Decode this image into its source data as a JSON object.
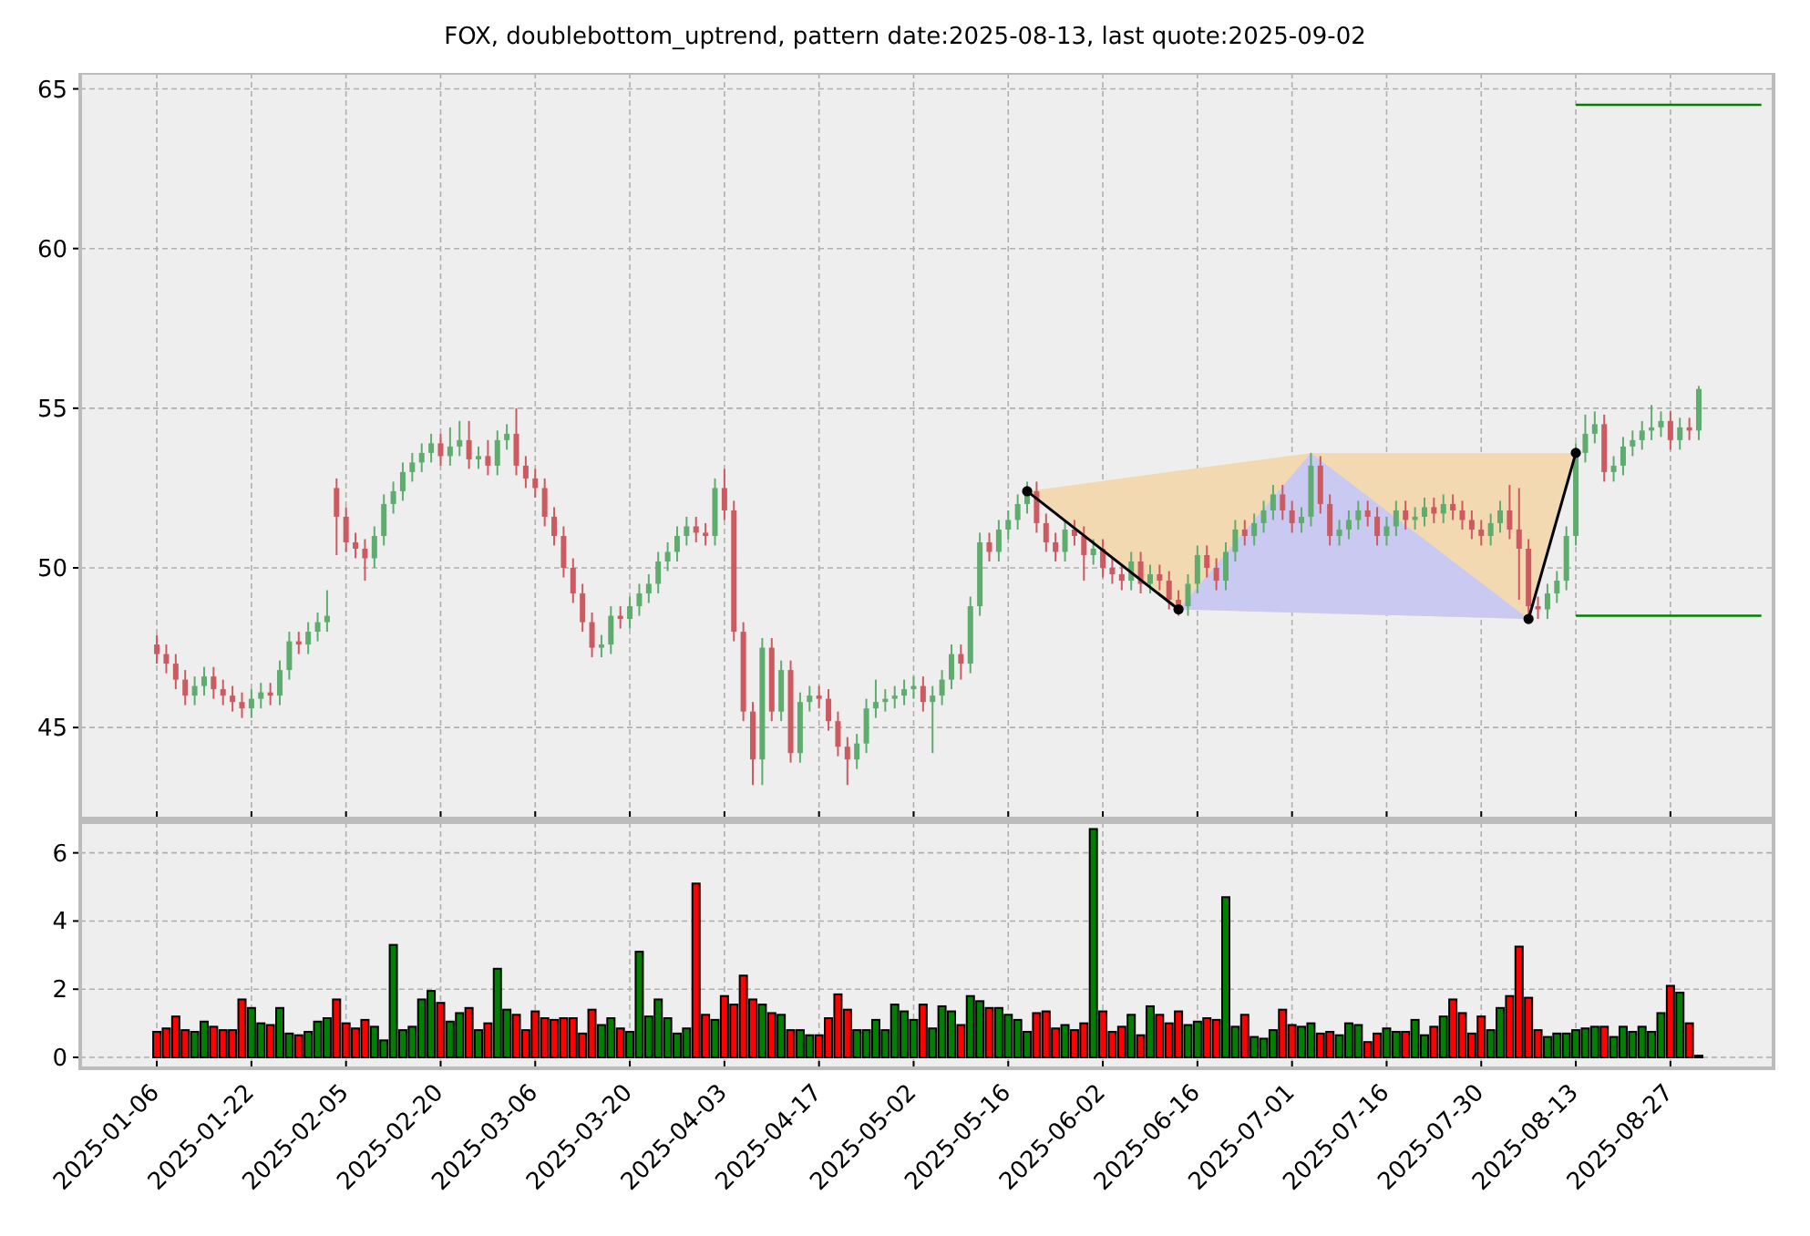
{
  "title": "FOX, doublebottom_uptrend, pattern date:2025-08-13, last quote:2025-09-02",
  "price_chart": {
    "chart_data": {
      "type": "candlestick",
      "grid": true,
      "ylim": [
        42.15,
        65.5
      ],
      "yticks": [
        45,
        50,
        55,
        60,
        65
      ],
      "ohlc": [
        [
          47.6,
          47.9,
          47.0,
          47.3
        ],
        [
          47.3,
          47.6,
          46.7,
          47.0
        ],
        [
          47.0,
          47.3,
          46.2,
          46.5
        ],
        [
          46.5,
          46.8,
          45.7,
          46.0
        ],
        [
          46.0,
          46.6,
          45.7,
          46.3
        ],
        [
          46.3,
          46.9,
          46.0,
          46.6
        ],
        [
          46.6,
          46.9,
          45.9,
          46.2
        ],
        [
          46.2,
          46.5,
          45.7,
          46.0
        ],
        [
          46.0,
          46.3,
          45.5,
          45.8
        ],
        [
          45.8,
          46.1,
          45.3,
          45.6
        ],
        [
          45.6,
          46.2,
          45.3,
          45.9
        ],
        [
          45.9,
          46.4,
          45.6,
          46.1
        ],
        [
          46.1,
          46.4,
          45.7,
          46.0
        ],
        [
          46.0,
          47.1,
          45.7,
          46.8
        ],
        [
          46.8,
          48.0,
          46.5,
          47.7
        ],
        [
          47.7,
          48.0,
          47.3,
          47.6
        ],
        [
          47.6,
          48.3,
          47.3,
          48.0
        ],
        [
          48.0,
          48.6,
          47.7,
          48.3
        ],
        [
          48.3,
          49.3,
          48.0,
          48.5
        ],
        [
          52.5,
          52.8,
          50.4,
          51.6
        ],
        [
          51.6,
          51.9,
          50.5,
          50.8
        ],
        [
          50.8,
          51.1,
          50.3,
          50.6
        ],
        [
          50.6,
          50.9,
          49.6,
          50.3
        ],
        [
          50.3,
          51.3,
          50.0,
          51.0
        ],
        [
          51.0,
          52.3,
          50.7,
          52.0
        ],
        [
          52.0,
          52.7,
          51.7,
          52.4
        ],
        [
          52.4,
          53.3,
          52.1,
          53.0
        ],
        [
          53.0,
          53.6,
          52.7,
          53.3
        ],
        [
          53.3,
          53.9,
          53.0,
          53.6
        ],
        [
          53.6,
          54.2,
          53.3,
          53.9
        ],
        [
          53.9,
          54.2,
          53.2,
          53.5
        ],
        [
          53.5,
          54.4,
          53.2,
          53.8
        ],
        [
          53.8,
          54.6,
          53.5,
          54.0
        ],
        [
          54.0,
          54.6,
          53.1,
          53.4
        ],
        [
          53.4,
          53.8,
          53.1,
          53.5
        ],
        [
          53.5,
          54.0,
          52.9,
          53.2
        ],
        [
          53.2,
          54.3,
          52.9,
          54.0
        ],
        [
          54.0,
          54.5,
          53.7,
          54.2
        ],
        [
          54.2,
          55.0,
          52.9,
          53.2
        ],
        [
          53.2,
          53.5,
          52.5,
          52.8
        ],
        [
          52.8,
          53.1,
          52.2,
          52.5
        ],
        [
          52.5,
          52.8,
          51.3,
          51.6
        ],
        [
          51.6,
          51.9,
          50.7,
          51.0
        ],
        [
          51.0,
          51.3,
          49.7,
          50.0
        ],
        [
          50.0,
          50.3,
          48.9,
          49.2
        ],
        [
          49.2,
          49.5,
          48.0,
          48.3
        ],
        [
          48.3,
          48.6,
          47.2,
          47.5
        ],
        [
          47.5,
          47.9,
          47.2,
          47.6
        ],
        [
          47.6,
          48.8,
          47.3,
          48.5
        ],
        [
          48.5,
          48.8,
          48.1,
          48.4
        ],
        [
          48.4,
          49.1,
          48.1,
          48.8
        ],
        [
          48.8,
          49.5,
          48.5,
          49.2
        ],
        [
          49.2,
          49.8,
          48.9,
          49.5
        ],
        [
          49.5,
          50.5,
          49.2,
          50.2
        ],
        [
          50.2,
          50.8,
          49.9,
          50.5
        ],
        [
          50.5,
          51.3,
          50.2,
          51.0
        ],
        [
          51.0,
          51.6,
          50.7,
          51.3
        ],
        [
          51.3,
          51.6,
          50.8,
          51.1
        ],
        [
          51.1,
          51.4,
          50.7,
          51.0
        ],
        [
          51.0,
          52.8,
          50.7,
          52.5
        ],
        [
          52.5,
          53.1,
          51.5,
          51.8
        ],
        [
          51.8,
          52.1,
          47.7,
          48.0
        ],
        [
          48.0,
          48.3,
          45.2,
          45.5
        ],
        [
          45.5,
          45.8,
          43.2,
          44.0
        ],
        [
          44.0,
          47.8,
          43.2,
          47.5
        ],
        [
          47.5,
          47.8,
          45.2,
          45.5
        ],
        [
          45.5,
          47.1,
          45.2,
          46.8
        ],
        [
          46.8,
          47.1,
          43.9,
          44.2
        ],
        [
          44.2,
          46.1,
          43.9,
          45.8
        ],
        [
          45.8,
          46.3,
          45.5,
          46.0
        ],
        [
          46.0,
          46.3,
          45.6,
          45.9
        ],
        [
          45.9,
          46.2,
          44.9,
          45.2
        ],
        [
          45.2,
          45.5,
          44.1,
          44.4
        ],
        [
          44.4,
          44.7,
          43.2,
          44.0
        ],
        [
          44.0,
          44.8,
          43.7,
          44.5
        ],
        [
          44.5,
          45.9,
          44.2,
          45.6
        ],
        [
          45.6,
          46.5,
          45.3,
          45.8
        ],
        [
          45.8,
          46.2,
          45.5,
          45.9
        ],
        [
          45.9,
          46.3,
          45.6,
          46.0
        ],
        [
          46.0,
          46.5,
          45.7,
          46.2
        ],
        [
          46.2,
          46.6,
          45.9,
          46.3
        ],
        [
          46.3,
          46.6,
          45.5,
          45.8
        ],
        [
          45.8,
          46.3,
          44.2,
          46.0
        ],
        [
          46.0,
          46.8,
          45.7,
          46.5
        ],
        [
          46.5,
          47.6,
          46.2,
          47.3
        ],
        [
          47.3,
          47.6,
          46.5,
          47.0
        ],
        [
          47.0,
          49.1,
          46.7,
          48.8
        ],
        [
          48.8,
          51.1,
          48.5,
          50.8
        ],
        [
          50.8,
          51.1,
          50.2,
          50.5
        ],
        [
          50.5,
          51.5,
          50.2,
          51.2
        ],
        [
          51.2,
          51.8,
          50.9,
          51.5
        ],
        [
          51.5,
          52.3,
          51.2,
          52.0
        ],
        [
          52.0,
          52.7,
          51.7,
          52.4
        ],
        [
          52.4,
          52.7,
          51.1,
          51.4
        ],
        [
          51.4,
          51.7,
          50.5,
          50.8
        ],
        [
          50.8,
          51.1,
          50.2,
          50.5
        ],
        [
          50.5,
          51.5,
          50.2,
          51.2
        ],
        [
          51.2,
          51.5,
          50.7,
          51.0
        ],
        [
          51.0,
          51.3,
          49.6,
          50.4
        ],
        [
          50.4,
          50.9,
          50.1,
          50.6
        ],
        [
          50.6,
          50.9,
          49.7,
          50.0
        ],
        [
          50.0,
          50.3,
          49.5,
          49.8
        ],
        [
          49.8,
          50.1,
          49.3,
          49.6
        ],
        [
          49.6,
          50.5,
          49.3,
          50.2
        ],
        [
          50.2,
          50.5,
          49.2,
          49.5
        ],
        [
          49.5,
          50.1,
          49.2,
          49.8
        ],
        [
          49.8,
          50.1,
          49.3,
          49.6
        ],
        [
          49.6,
          49.9,
          48.7,
          49.0
        ],
        [
          49.0,
          49.3,
          48.5,
          48.8
        ],
        [
          48.8,
          49.8,
          48.5,
          49.5
        ],
        [
          49.5,
          50.7,
          49.2,
          50.4
        ],
        [
          50.4,
          50.7,
          49.7,
          50.0
        ],
        [
          50.0,
          50.3,
          49.3,
          49.6
        ],
        [
          49.6,
          50.8,
          49.3,
          50.5
        ],
        [
          50.5,
          51.5,
          50.2,
          51.2
        ],
        [
          51.2,
          51.5,
          50.7,
          51.0
        ],
        [
          51.0,
          51.7,
          50.7,
          51.4
        ],
        [
          51.4,
          52.1,
          51.1,
          51.8
        ],
        [
          51.8,
          52.6,
          51.5,
          52.3
        ],
        [
          52.3,
          52.6,
          51.5,
          51.8
        ],
        [
          51.8,
          52.1,
          51.1,
          51.4
        ],
        [
          51.4,
          51.9,
          51.1,
          51.6
        ],
        [
          51.6,
          53.6,
          51.3,
          53.2
        ],
        [
          53.2,
          53.5,
          51.7,
          52.0
        ],
        [
          52.0,
          52.3,
          50.7,
          51.0
        ],
        [
          51.0,
          51.5,
          50.7,
          51.2
        ],
        [
          51.2,
          51.8,
          50.9,
          51.5
        ],
        [
          51.5,
          52.1,
          51.2,
          51.8
        ],
        [
          51.8,
          52.1,
          51.3,
          51.6
        ],
        [
          51.6,
          51.9,
          50.7,
          51.0
        ],
        [
          51.0,
          51.6,
          50.7,
          51.3
        ],
        [
          51.3,
          52.1,
          51.0,
          51.8
        ],
        [
          51.8,
          52.1,
          51.2,
          51.5
        ],
        [
          51.5,
          51.9,
          51.2,
          51.6
        ],
        [
          51.6,
          52.2,
          51.3,
          51.9
        ],
        [
          51.9,
          52.2,
          51.4,
          51.7
        ],
        [
          51.7,
          52.3,
          51.4,
          52.0
        ],
        [
          52.0,
          52.3,
          51.5,
          51.8
        ],
        [
          51.8,
          52.1,
          51.2,
          51.5
        ],
        [
          51.5,
          51.8,
          50.9,
          51.2
        ],
        [
          51.2,
          51.5,
          50.7,
          51.0
        ],
        [
          51.0,
          51.7,
          50.7,
          51.4
        ],
        [
          51.4,
          52.1,
          51.1,
          51.8
        ],
        [
          51.8,
          52.6,
          50.9,
          51.2
        ],
        [
          51.2,
          52.5,
          49.0,
          50.6
        ],
        [
          50.6,
          50.9,
          48.4,
          48.8
        ],
        [
          48.8,
          49.1,
          48.4,
          48.7
        ],
        [
          48.7,
          49.5,
          48.4,
          49.2
        ],
        [
          49.2,
          49.9,
          48.9,
          49.6
        ],
        [
          49.6,
          51.3,
          49.3,
          51.0
        ],
        [
          51.0,
          53.9,
          50.7,
          53.6
        ],
        [
          53.6,
          54.8,
          53.3,
          54.2
        ],
        [
          54.2,
          54.9,
          53.9,
          54.5
        ],
        [
          54.5,
          54.8,
          52.7,
          53.0
        ],
        [
          53.0,
          53.5,
          52.7,
          53.2
        ],
        [
          53.2,
          54.1,
          52.9,
          53.8
        ],
        [
          53.8,
          54.3,
          53.5,
          54.0
        ],
        [
          54.0,
          54.6,
          53.7,
          54.3
        ],
        [
          54.3,
          55.1,
          54.0,
          54.4
        ],
        [
          54.4,
          54.9,
          54.1,
          54.6
        ],
        [
          54.6,
          54.9,
          53.7,
          54.0
        ],
        [
          54.0,
          54.7,
          53.7,
          54.4
        ],
        [
          54.4,
          54.7,
          54.0,
          54.3
        ],
        [
          54.3,
          55.7,
          54.0,
          55.6
        ]
      ],
      "ref_lines": [
        {
          "axis": "y",
          "value": 64.5,
          "color": "#008000"
        },
        {
          "axis": "y",
          "value": 48.5,
          "color": "#008000"
        }
      ]
    }
  },
  "volume_chart": {
    "chart_data": {
      "type": "bar",
      "grid": true,
      "ylim": [
        -0.32,
        6.9
      ],
      "yticks": [
        0,
        2,
        4,
        6
      ],
      "categories": [
        "2025-01-06",
        null,
        null,
        null,
        null,
        null,
        null,
        null,
        null,
        null,
        "2025-01-22",
        null,
        null,
        null,
        null,
        null,
        null,
        null,
        null,
        null,
        "2025-02-05",
        null,
        null,
        null,
        null,
        null,
        null,
        null,
        null,
        null,
        "2025-02-20",
        null,
        null,
        null,
        null,
        null,
        null,
        null,
        null,
        null,
        "2025-03-06",
        null,
        null,
        null,
        null,
        null,
        null,
        null,
        null,
        null,
        "2025-03-20",
        null,
        null,
        null,
        null,
        null,
        null,
        null,
        null,
        null,
        "2025-04-03",
        null,
        null,
        null,
        null,
        null,
        null,
        null,
        null,
        null,
        "2025-04-17",
        null,
        null,
        null,
        null,
        null,
        null,
        null,
        null,
        null,
        "2025-05-02",
        null,
        null,
        null,
        null,
        null,
        null,
        null,
        null,
        null,
        "2025-05-16",
        null,
        null,
        null,
        null,
        null,
        null,
        null,
        null,
        null,
        "2025-06-02",
        null,
        null,
        null,
        null,
        null,
        null,
        null,
        null,
        null,
        "2025-06-16",
        null,
        null,
        null,
        null,
        null,
        null,
        null,
        null,
        null,
        "2025-07-01",
        null,
        null,
        null,
        null,
        null,
        null,
        null,
        null,
        null,
        "2025-07-16",
        null,
        null,
        null,
        null,
        null,
        null,
        null,
        null,
        null,
        "2025-07-30",
        null,
        null,
        null,
        null,
        null,
        null,
        null,
        null,
        null,
        "2025-08-13",
        null,
        null,
        null,
        null,
        null,
        null,
        null,
        null,
        null,
        "2025-08-27",
        null,
        null,
        null
      ],
      "series": [
        {
          "color": "#008000",
          "values": [
            null,
            null,
            null,
            null,
            0.75,
            1.05,
            null,
            null,
            null,
            null,
            1.45,
            1.0,
            null,
            1.45,
            0.7,
            null,
            0.75,
            1.05,
            1.15,
            null,
            null,
            null,
            null,
            0.9,
            0.5,
            3.3,
            0.8,
            0.9,
            1.7,
            1.95,
            null,
            1.05,
            1.3,
            null,
            0.8,
            null,
            2.6,
            1.4,
            null,
            null,
            null,
            null,
            null,
            null,
            null,
            null,
            null,
            0.95,
            1.15,
            null,
            0.75,
            3.1,
            1.2,
            1.7,
            1.15,
            0.7,
            0.85,
            null,
            null,
            1.1,
            null,
            null,
            null,
            null,
            1.55,
            null,
            1.25,
            null,
            0.8,
            0.65,
            null,
            null,
            null,
            null,
            0.8,
            0.8,
            1.1,
            0.8,
            1.55,
            1.35,
            1.1,
            null,
            0.85,
            1.5,
            1.35,
            null,
            1.8,
            1.65,
            null,
            1.45,
            1.25,
            1.1,
            0.75,
            null,
            null,
            null,
            0.95,
            null,
            null,
            6.7,
            null,
            null,
            null,
            1.25,
            null,
            1.5,
            null,
            null,
            null,
            0.95,
            1.05,
            null,
            null,
            4.7,
            0.9,
            null,
            0.6,
            0.55,
            0.8,
            null,
            null,
            0.9,
            1.0,
            null,
            null,
            0.65,
            1.0,
            0.95,
            null,
            null,
            0.85,
            0.75,
            null,
            1.1,
            0.65,
            null,
            1.2,
            null,
            null,
            null,
            null,
            0.8,
            1.45,
            null,
            null,
            null,
            null,
            0.6,
            0.7,
            0.7,
            0.8,
            0.85,
            0.9,
            null,
            0.6,
            0.9,
            0.75,
            0.9,
            0.75,
            1.3,
            null,
            1.9,
            null,
            0.05
          ]
        },
        {
          "color": "#ff0000",
          "values": [
            0.75,
            0.85,
            1.2,
            0.8,
            null,
            null,
            0.9,
            0.8,
            0.8,
            1.7,
            null,
            null,
            0.95,
            null,
            null,
            0.65,
            null,
            null,
            null,
            1.7,
            1.0,
            0.85,
            1.1,
            null,
            null,
            null,
            null,
            null,
            null,
            null,
            1.6,
            null,
            null,
            1.45,
            null,
            1.0,
            null,
            null,
            1.25,
            0.8,
            1.35,
            1.15,
            1.1,
            1.15,
            1.15,
            0.7,
            1.4,
            null,
            null,
            0.85,
            null,
            null,
            null,
            null,
            null,
            null,
            null,
            5.1,
            1.25,
            null,
            1.8,
            1.55,
            2.4,
            1.7,
            null,
            1.3,
            null,
            0.8,
            null,
            null,
            0.65,
            1.15,
            1.85,
            1.4,
            null,
            null,
            null,
            null,
            null,
            null,
            null,
            1.55,
            null,
            null,
            null,
            0.95,
            null,
            null,
            1.45,
            null,
            null,
            null,
            null,
            1.3,
            1.35,
            0.85,
            null,
            0.8,
            1.0,
            null,
            1.35,
            0.75,
            0.9,
            null,
            0.65,
            null,
            1.25,
            1.0,
            1.35,
            null,
            null,
            1.15,
            1.1,
            null,
            null,
            1.25,
            null,
            null,
            null,
            1.4,
            0.95,
            null,
            null,
            0.7,
            0.75,
            null,
            null,
            null,
            0.45,
            0.7,
            null,
            null,
            0.75,
            null,
            null,
            0.9,
            null,
            1.7,
            1.3,
            0.7,
            1.2,
            null,
            null,
            1.8,
            3.25,
            1.75,
            0.8,
            null,
            null,
            null,
            null,
            null,
            null,
            0.9,
            null,
            null,
            null,
            null,
            null,
            null,
            2.1,
            null,
            1.0,
            null
          ]
        }
      ]
    }
  }
}
